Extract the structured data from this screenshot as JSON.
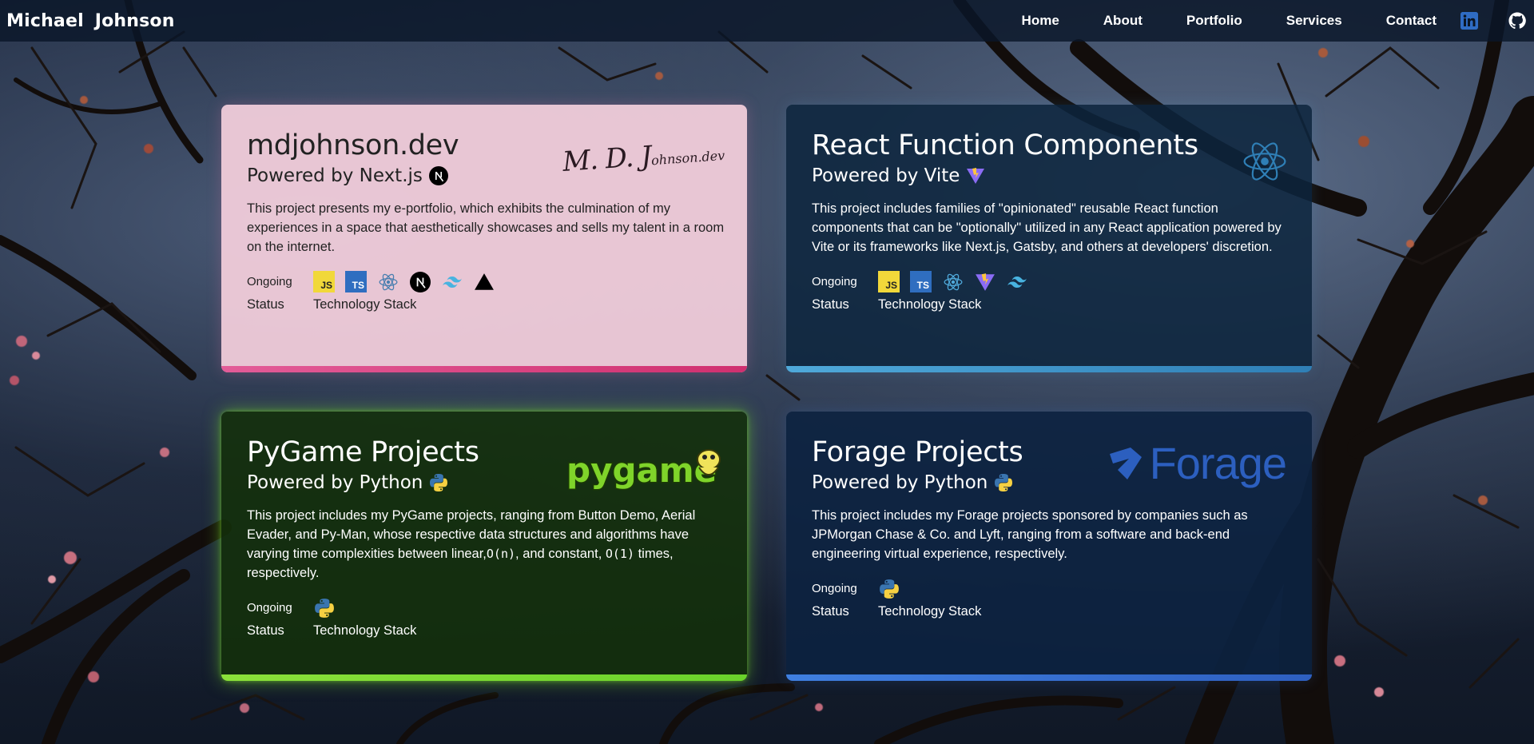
{
  "brand": "Michael Johnson",
  "nav": {
    "links": [
      "Home",
      "About",
      "Portfolio",
      "Services",
      "Contact"
    ],
    "icons": [
      "linkedin-icon",
      "github-icon"
    ]
  },
  "cards": [
    {
      "title": "mdjohnson.dev",
      "subtitle": "Powered by Next.js",
      "subtitle_icon": "nextjs-icon",
      "logo_text": "M. D. Johnson.dev",
      "description": "This project presents my e-portfolio, which exhibits the culmination of my experiences in a space that aesthetically showcases and sells my talent in a room on the internet.",
      "status": "Ongoing",
      "status_label": "Status",
      "stack_label": "Technology Stack",
      "stack": [
        "javascript-icon",
        "typescript-icon",
        "react-icon",
        "nextjs-icon",
        "tailwind-icon",
        "vercel-icon"
      ],
      "accent": "#d0306f"
    },
    {
      "title": "React Function Components",
      "subtitle": "Powered by Vite",
      "subtitle_icon": "vite-icon",
      "description": "This project includes families of \"opinionated\" reusable React function components that can be \"optionally\" utilized in any React application powered by Vite or its frameworks like Next.js, Gatsby, and others at developers' discretion.",
      "status": "Ongoing",
      "status_label": "Status",
      "stack_label": "Technology Stack",
      "stack": [
        "javascript-icon",
        "typescript-icon",
        "react-icon",
        "vite-icon",
        "tailwind-icon"
      ],
      "accent": "#2f7fb6"
    },
    {
      "title": "PyGame Projects",
      "subtitle": "Powered by Python",
      "subtitle_icon": "python-icon",
      "logo_text": "pygame",
      "description_parts": [
        "This project includes my PyGame projects, ranging from Button Demo, Aerial Evader, and Py-Man, whose respective data structures and algorithms have varying time complexities between linear,",
        "O(n)",
        ", and constant, ",
        "O(1)",
        " times, respectively."
      ],
      "status": "Ongoing",
      "status_label": "Status",
      "stack_label": "Technology Stack",
      "stack": [
        "python-icon"
      ],
      "accent": "#6ad22b"
    },
    {
      "title": "Forage Projects",
      "subtitle": "Powered by Python",
      "subtitle_icon": "python-icon",
      "logo_text": "Forage",
      "description": "This project includes my Forage projects sponsored by companies such as JPMorgan Chase & Co. and Lyft, ranging from a software and back-end engineering virtual experience, respectively.",
      "status": "Ongoing",
      "status_label": "Status",
      "stack_label": "Technology Stack",
      "stack": [
        "python-icon"
      ],
      "accent": "#2e5fc0"
    }
  ],
  "tech_labels": {
    "js": "JS",
    "ts": "TS"
  }
}
